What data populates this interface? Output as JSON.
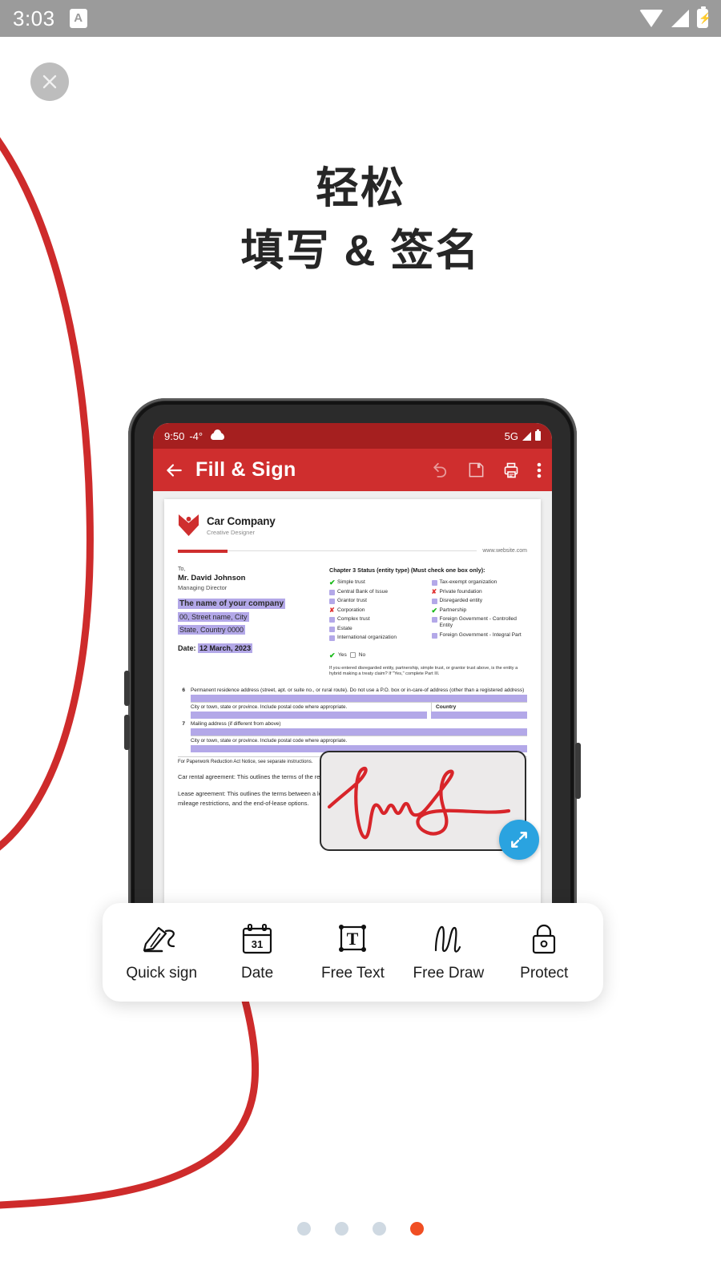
{
  "status_bar": {
    "time": "3:03",
    "app_badge": "A",
    "icons": [
      "wifi-icon",
      "signal-icon",
      "battery-charging-icon"
    ],
    "background": "#9b9b9b"
  },
  "close_button": {
    "icon": "close-icon",
    "label": "Close"
  },
  "headline": {
    "line1": "轻松",
    "line2": "填写 & 签名"
  },
  "phone": {
    "status_bar": {
      "time": "9:50",
      "temperature": "-4°",
      "weather_icon": "cloud-icon",
      "network": "5G",
      "icons": [
        "signal-icon",
        "battery-icon"
      ],
      "background": "#a51f1f"
    },
    "app_bar": {
      "back_label": "←",
      "title": "Fill & Sign",
      "background": "#cf2e2e",
      "actions": [
        {
          "name": "undo-icon",
          "label": "Undo"
        },
        {
          "name": "save-icon",
          "label": "Save"
        },
        {
          "name": "print-icon",
          "label": "Print"
        },
        {
          "name": "more-options-icon",
          "label": "More options"
        }
      ]
    },
    "document": {
      "company_name": "Car Company",
      "company_tagline": "Creative Designer",
      "website": "www.website.com",
      "to_label": "To,",
      "recipient_name": "Mr. David Johnson",
      "recipient_role": "Managing Director",
      "field_company": "The name of your company",
      "field_street": "00, Street name, City",
      "field_state": "State, Country 0000",
      "date_label": "Date:",
      "date_value": "12 March, 2023",
      "chapter_title": "Chapter 3 Status (entity type) (Must check one box only):",
      "checkboxes_left": [
        {
          "label": "Simple trust",
          "state": "checked"
        },
        {
          "label": "Central Bank of Issue",
          "state": "empty"
        },
        {
          "label": "Grantor trust",
          "state": "empty"
        },
        {
          "label": "Corporation",
          "state": "crossed"
        },
        {
          "label": "Complex trust",
          "state": "empty"
        },
        {
          "label": "Estate",
          "state": "empty"
        },
        {
          "label": "International organization",
          "state": "empty"
        }
      ],
      "checkboxes_right": [
        {
          "label": "Tax-exempt organization",
          "state": "empty"
        },
        {
          "label": "Private foundation",
          "state": "crossed"
        },
        {
          "label": "Disregarded entity",
          "state": "empty"
        },
        {
          "label": "Partnership",
          "state": "checked"
        },
        {
          "label": "Foreign Government - Controlled Entity",
          "state": "empty"
        },
        {
          "label": "Foreign Government - Integral Part",
          "state": "empty"
        }
      ],
      "yes_label": "Yes",
      "no_label": "No",
      "fine_print": "If you entered disregarded entity, partnership, simple trust, or grantor trust above, is the entity a hybrid making a treaty claim? If \"Yes,\" complete Part III.",
      "row6_num": "6",
      "row6_label": "Permanent residence address (street, apt. or suite no., or rural route). Do not use a P.O. box or in-care-of address  (other than a registered address)",
      "row6_city": "City or town, state or province. Include postal code where appropriate.",
      "row6_country": "Country",
      "row7_num": "7",
      "row7_label": "Mailing address (if different from above)",
      "row7_city": "City or town, state or province. Include postal code where appropriate.",
      "notice": "For Paperwork Reduction Act Notice, see separate instructions.",
      "para1": "Car rental agreement: This outlines the terms of the rental, the insurance coverage, and the responsibilities of each party.",
      "para2": "Lease agreement: This outlines the terms between a lessor and a lessee (the person who is leasing), the monthly payment, the mileage restrictions, and the end-of-lease options.",
      "signature_color": "#d8252a"
    },
    "resize_handle": {
      "icon": "resize-expand-icon",
      "color": "#2aa3e0"
    }
  },
  "toolbar": {
    "tools": [
      {
        "icon": "quick-sign-icon",
        "label": "Quick sign"
      },
      {
        "icon": "calendar-date-icon",
        "label": "Date",
        "day": "31"
      },
      {
        "icon": "free-text-icon",
        "label": "Free Text",
        "glyph": "T"
      },
      {
        "icon": "free-draw-icon",
        "label": "Free Draw"
      },
      {
        "icon": "protect-lock-icon",
        "label": "Protect"
      }
    ]
  },
  "pagination": {
    "total": 4,
    "active_index": 3,
    "active_color": "#f04e23",
    "inactive_color": "#cfd9e2"
  },
  "theme": {
    "brand_red": "#cf2e2e",
    "decor_red": "#ce2b2b",
    "highlight_purple": "#b3a8e8",
    "check_green": "#14b814",
    "cross_red": "#e03131"
  }
}
